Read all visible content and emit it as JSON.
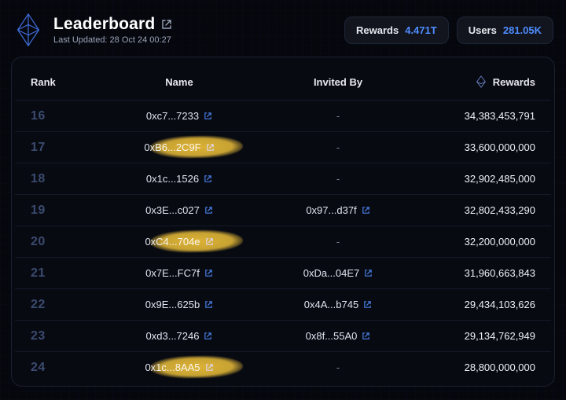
{
  "header": {
    "title": "Leaderboard",
    "last_updated_label": "Last Updated: 28 Oct 24 00:27",
    "stats": {
      "rewards_label": "Rewards",
      "rewards_value": "4.471T",
      "users_label": "Users",
      "users_value": "281.05K"
    }
  },
  "columns": {
    "rank": "Rank",
    "name": "Name",
    "invited_by": "Invited By",
    "rewards": "Rewards"
  },
  "rows": [
    {
      "rank": "16",
      "name": "0xc7...7233",
      "invited_by": "-",
      "rewards": "34,383,453,791",
      "highlight": false
    },
    {
      "rank": "17",
      "name": "0xB6...2C9F",
      "invited_by": "-",
      "rewards": "33,600,000,000",
      "highlight": true
    },
    {
      "rank": "18",
      "name": "0x1c...1526",
      "invited_by": "-",
      "rewards": "32,902,485,000",
      "highlight": false
    },
    {
      "rank": "19",
      "name": "0x3E...c027",
      "invited_by": "0x97...d37f",
      "rewards": "32,802,433,290",
      "highlight": false
    },
    {
      "rank": "20",
      "name": "0xC4...704e",
      "invited_by": "-",
      "rewards": "32,200,000,000",
      "highlight": true
    },
    {
      "rank": "21",
      "name": "0x7E...FC7f",
      "invited_by": "0xDa...04E7",
      "rewards": "31,960,663,843",
      "highlight": false
    },
    {
      "rank": "22",
      "name": "0x9E...625b",
      "invited_by": "0x4A...b745",
      "rewards": "29,434,103,626",
      "highlight": false
    },
    {
      "rank": "23",
      "name": "0xd3...7246",
      "invited_by": "0x8f...55A0",
      "rewards": "29,134,762,949",
      "highlight": false
    },
    {
      "rank": "24",
      "name": "0x1c...8AA5",
      "invited_by": "-",
      "rewards": "28,800,000,000",
      "highlight": true
    }
  ]
}
